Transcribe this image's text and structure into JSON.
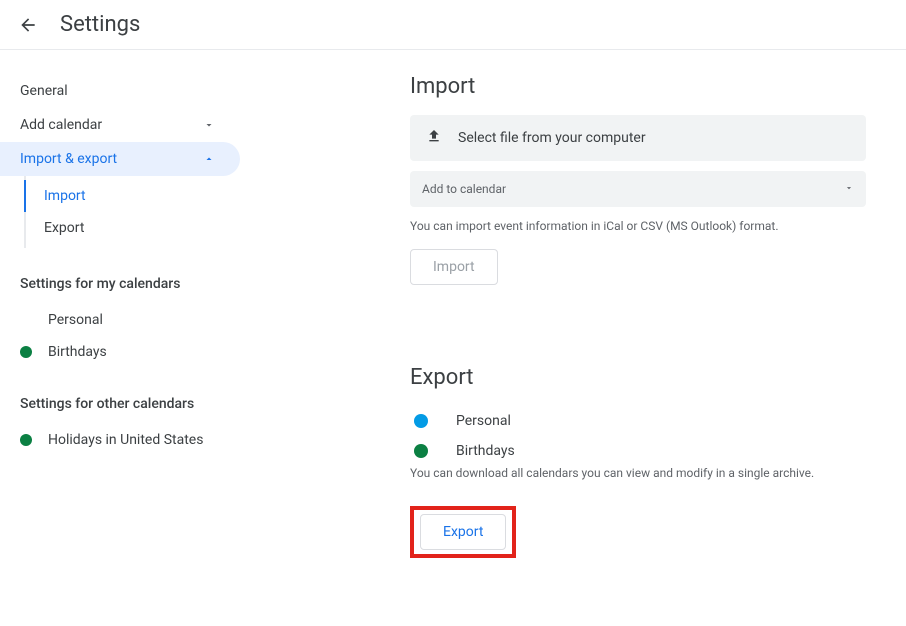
{
  "header": {
    "title": "Settings"
  },
  "sidebar": {
    "nav": {
      "general": "General",
      "add_calendar": "Add calendar",
      "import_export": "Import & export"
    },
    "subnav": {
      "import": "Import",
      "export": "Export"
    },
    "my_calendars_header": "Settings for my calendars",
    "my_calendars": [
      {
        "label": "Personal",
        "color": "#039be5"
      },
      {
        "label": "Birthdays",
        "color": "#0b8043"
      }
    ],
    "other_calendars_header": "Settings for other calendars",
    "other_calendars": [
      {
        "label": "Holidays in United States",
        "color": "#0b8043"
      }
    ]
  },
  "main": {
    "import": {
      "title": "Import",
      "select_file": "Select file from your computer",
      "dropdown_label": "Add to calendar",
      "help": "You can import event information in iCal or CSV (MS Outlook) format.",
      "button": "Import"
    },
    "export": {
      "title": "Export",
      "calendars": [
        {
          "label": "Personal",
          "color": "#039be5"
        },
        {
          "label": "Birthdays",
          "color": "#0b8043"
        }
      ],
      "help": "You can download all calendars you can view and modify in a single archive.",
      "button": "Export"
    }
  },
  "colors": {
    "blue": "#039be5",
    "green": "#0b8043"
  }
}
